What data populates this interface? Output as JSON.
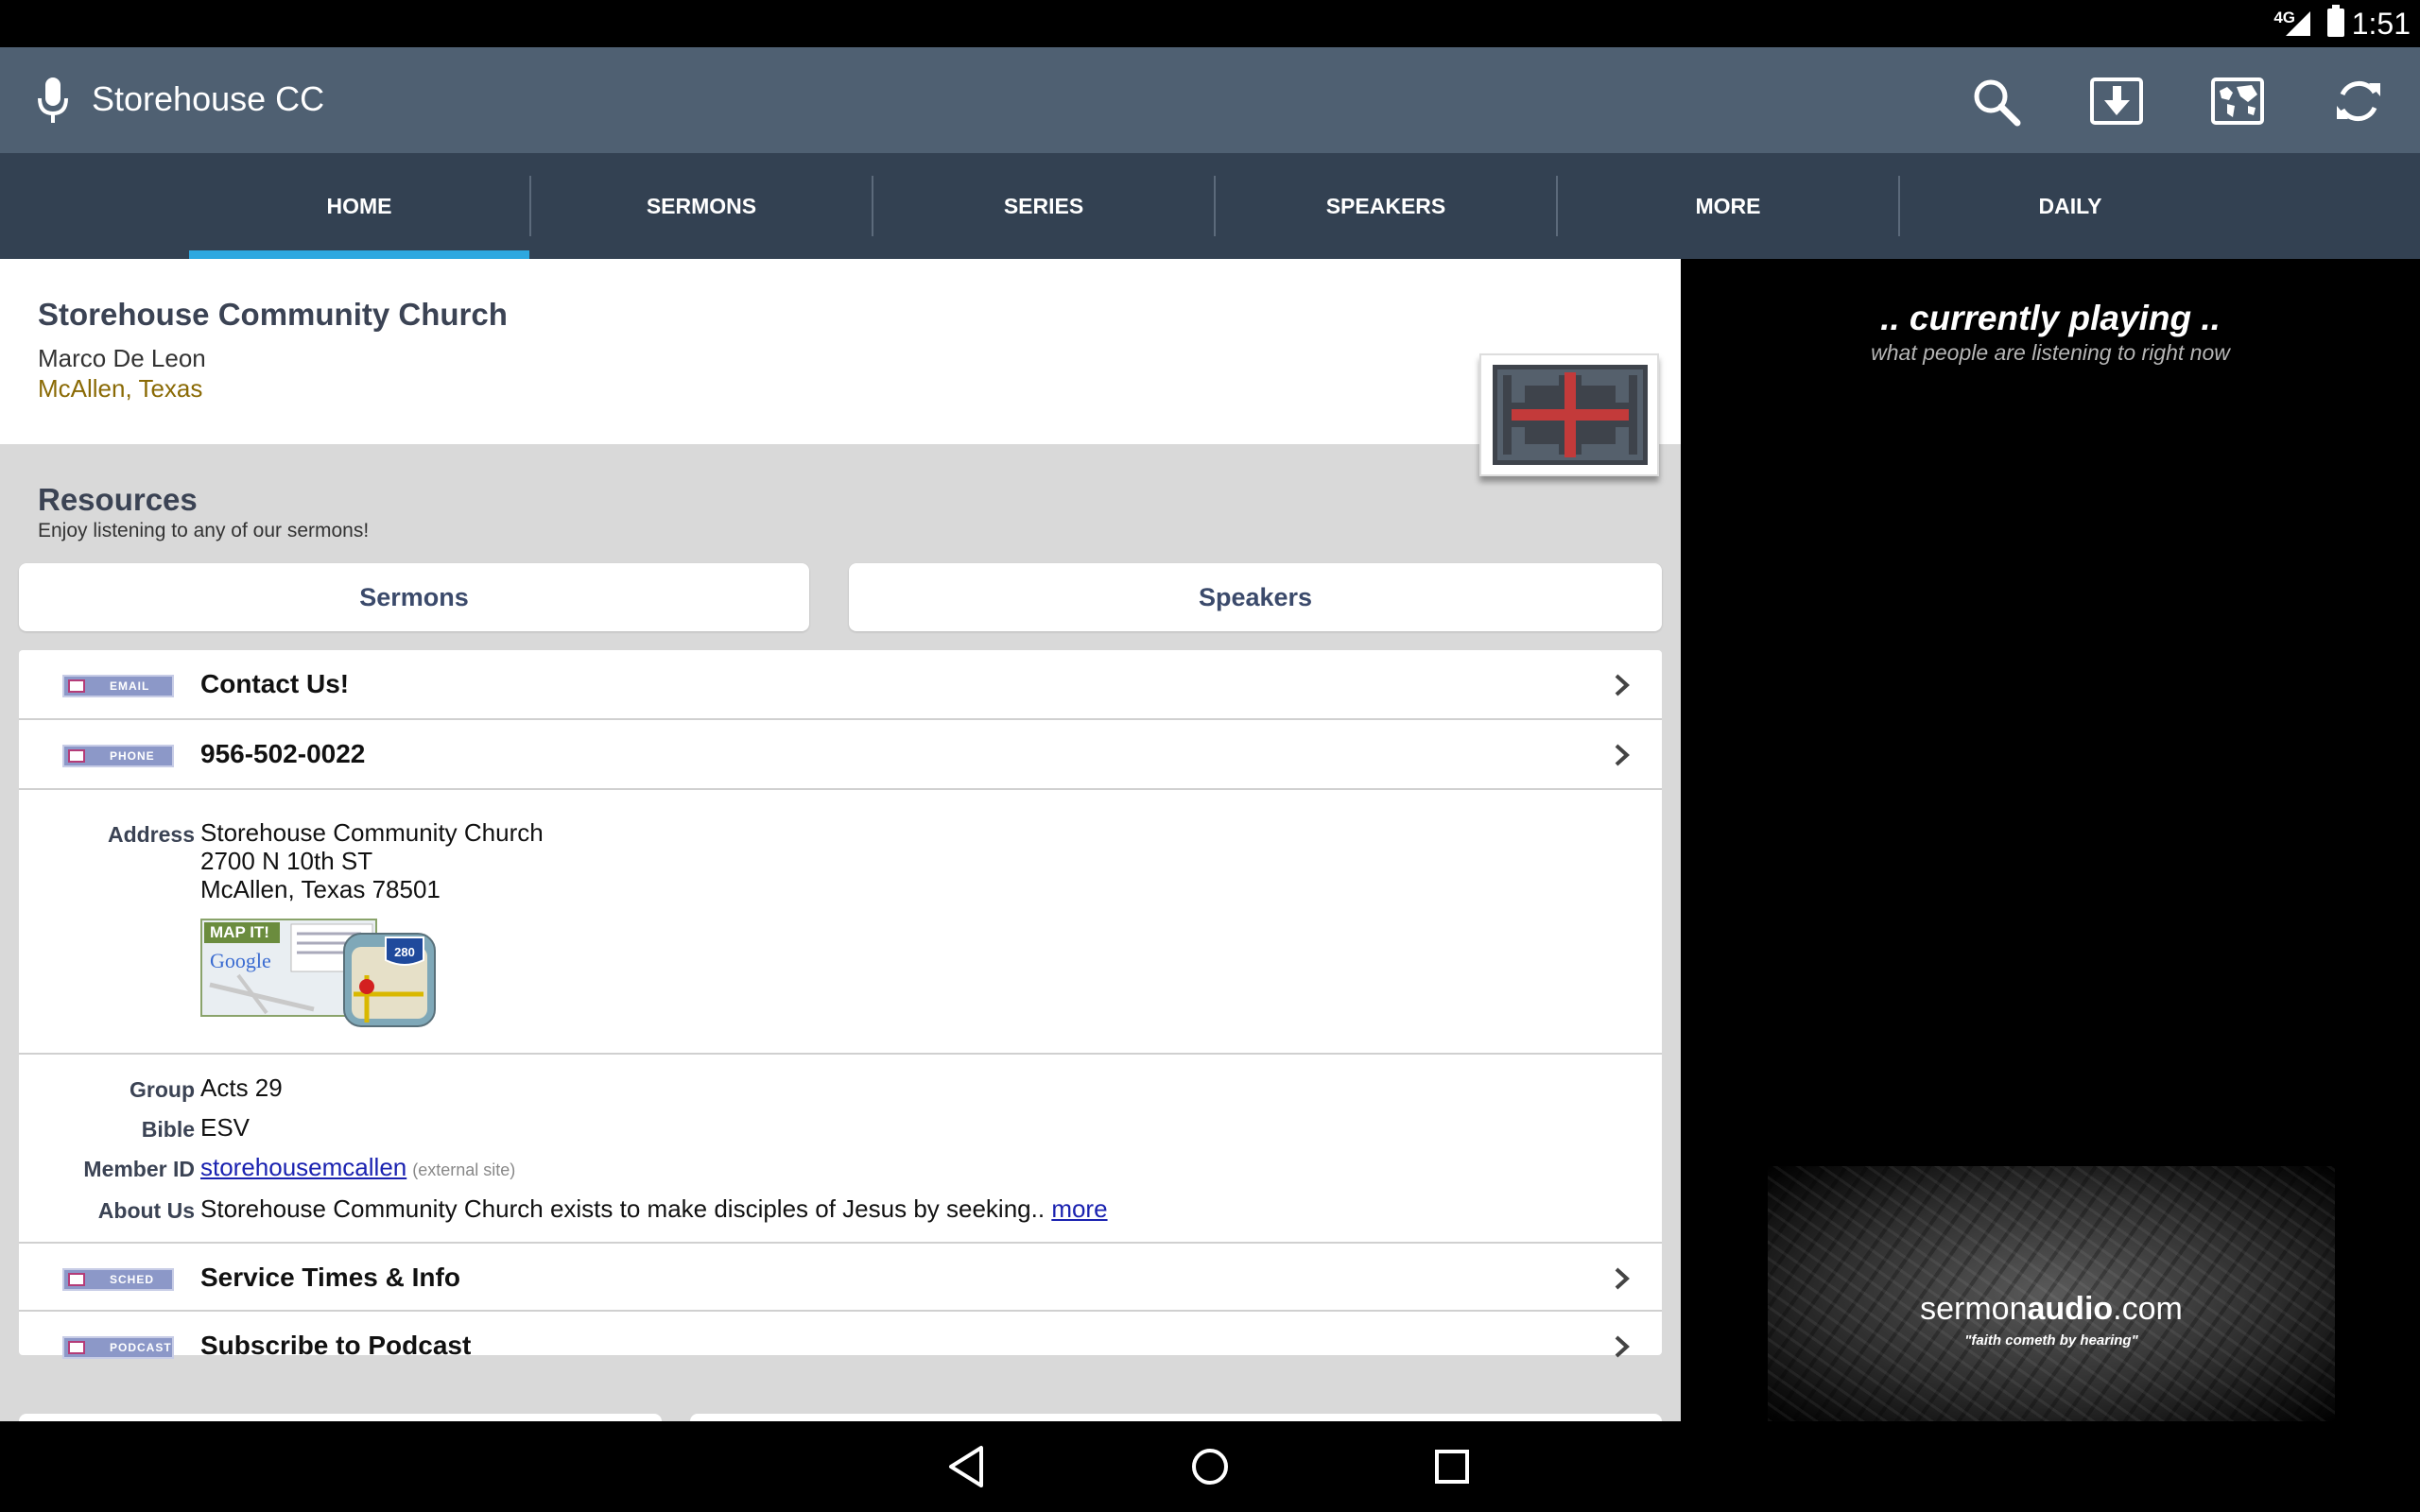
{
  "status_bar": {
    "network": "4G",
    "time": "1:51"
  },
  "app_bar": {
    "title": "Storehouse CC",
    "icons": [
      "mic-icon",
      "search-icon",
      "download-icon",
      "world-map-icon",
      "refresh-icon"
    ]
  },
  "tabs": [
    {
      "label": "HOME",
      "active": true
    },
    {
      "label": "SERMONS",
      "active": false
    },
    {
      "label": "SERIES",
      "active": false
    },
    {
      "label": "SPEAKERS",
      "active": false
    },
    {
      "label": "MORE",
      "active": false
    },
    {
      "label": "DAILY",
      "active": false
    }
  ],
  "church": {
    "name": "Storehouse Community Church",
    "pastor": "Marco De Leon",
    "location": "McAllen, Texas"
  },
  "resources": {
    "title": "Resources",
    "subtitle": "Enjoy listening to any of our sermons!",
    "buttons": [
      "Sermons",
      "Speakers"
    ]
  },
  "contact_rows": [
    {
      "badge": "EMAIL",
      "label": "Contact Us!"
    },
    {
      "badge": "PHONE",
      "label": "956-502-0022"
    }
  ],
  "address": {
    "label": "Address",
    "lines": [
      "Storehouse Community Church",
      "2700 N 10th ST",
      "McAllen, Texas 78501"
    ],
    "map_button": "MAP IT!",
    "map_brand": "Google",
    "highway": "280"
  },
  "info": [
    {
      "label": "Group",
      "value": "Acts 29"
    },
    {
      "label": "Bible",
      "value": "ESV"
    },
    {
      "label": "Member ID",
      "value": "storehousemcallen",
      "note": "(external site)"
    },
    {
      "label": "About Us",
      "value": "Storehouse Community Church exists to make disciples of Jesus by seeking..",
      "more": "more"
    }
  ],
  "bottom_rows": [
    {
      "badge": "SCHED",
      "label": "Service Times & Info"
    },
    {
      "badge": "PODCAST",
      "label": "Subscribe to Podcast"
    }
  ],
  "right_panel": {
    "title": ".. currently playing ..",
    "subtitle": "what people are listening to right now",
    "brand_light": "sermon",
    "brand_bold": "audio",
    "brand_suffix": ".com",
    "tagline": "\"faith cometh by hearing\""
  },
  "nav_bar": {
    "buttons": [
      "back-button",
      "home-button",
      "recents-button"
    ]
  },
  "colors": {
    "app_bar": "#4f6072",
    "tab_bar": "#334152",
    "tab_indicator": "#2ea8e0",
    "location": "#8a6a05",
    "link": "#1a22b0",
    "badge": "#8c98c8"
  }
}
